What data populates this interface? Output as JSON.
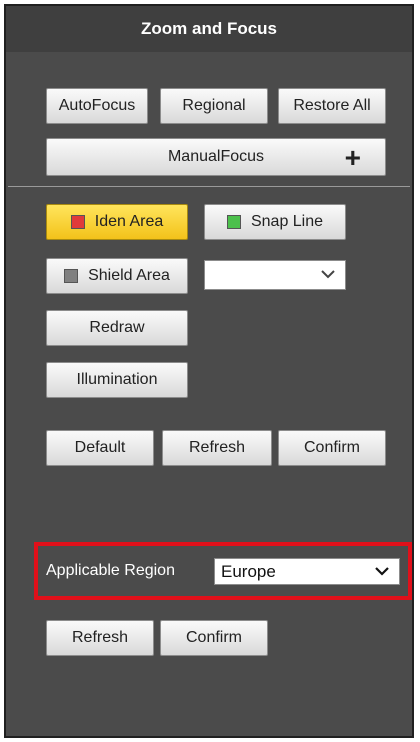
{
  "panel": {
    "title": "Zoom and Focus"
  },
  "focus": {
    "autofocus_label": "AutoFocus",
    "regional_label": "Regional",
    "restore_all_label": "Restore All",
    "manual_focus_label": "ManualFocus",
    "manual_focus_plus": "+"
  },
  "areas": {
    "iden_area_label": "Iden Area",
    "iden_area_color": "#e03a3a",
    "snap_line_label": "Snap Line",
    "snap_line_color": "#4cc04c",
    "shield_area_label": "Shield Area",
    "shield_area_color": "#808080",
    "dropdown_value": "",
    "redraw_label": "Redraw",
    "illumination_label": "Illumination"
  },
  "actions": {
    "default_label": "Default",
    "refresh_label": "Refresh",
    "confirm_label": "Confirm"
  },
  "region": {
    "label": "Applicable Region",
    "selected_value": "Europe",
    "refresh_label": "Refresh",
    "confirm_label": "Confirm"
  },
  "icons": {
    "dropdown_chevron": "chevron-down-icon",
    "plus": "plus-icon"
  }
}
